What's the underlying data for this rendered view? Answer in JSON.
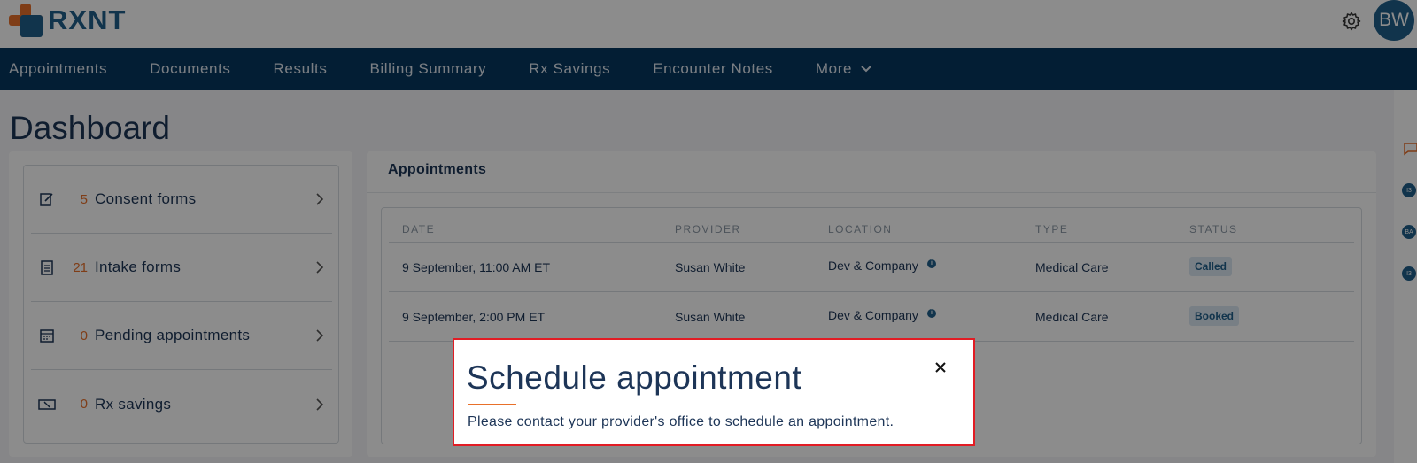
{
  "header": {
    "logo_text": "RXNT",
    "avatar_initials": "BW",
    "settings_icon": "gear-icon"
  },
  "nav": {
    "items": [
      {
        "label": "Appointments"
      },
      {
        "label": "Documents"
      },
      {
        "label": "Results"
      },
      {
        "label": "Billing Summary"
      },
      {
        "label": "Rx Savings"
      },
      {
        "label": "Encounter Notes"
      },
      {
        "label": "More"
      }
    ]
  },
  "page": {
    "title": "Dashboard"
  },
  "summary": {
    "items": [
      {
        "count": "5",
        "label": "Consent forms",
        "icon": "edit-form-icon"
      },
      {
        "count": "21",
        "label": "Intake forms",
        "icon": "clipboard-icon"
      },
      {
        "count": "0",
        "label": "Pending appointments",
        "icon": "calendar-icon"
      },
      {
        "count": "0",
        "label": "Rx savings",
        "icon": "coupon-icon"
      }
    ]
  },
  "appointments": {
    "title": "Appointments",
    "columns": [
      "DATE",
      "PROVIDER",
      "LOCATION",
      "TYPE",
      "STATUS"
    ],
    "rows": [
      {
        "date": "9 September, 11:00 AM ET",
        "provider": "Susan White",
        "location": "Dev & Company",
        "type": "Medical Care",
        "status": "Called"
      },
      {
        "date": "9 September, 2:00 PM ET",
        "provider": "Susan White",
        "location": "Dev & Company",
        "type": "Medical Care",
        "status": "Booked"
      }
    ]
  },
  "rail": {
    "avatars": [
      "I3",
      "BA",
      "I3"
    ]
  },
  "modal": {
    "title": "Schedule appointment",
    "message": "Please contact your provider's office to schedule an appointment.",
    "close_icon": "close-icon"
  },
  "colors": {
    "brand_blue": "#1f5f8b",
    "nav_bg": "#06375f",
    "accent_orange": "#e8702a",
    "modal_border": "#e21c24"
  }
}
